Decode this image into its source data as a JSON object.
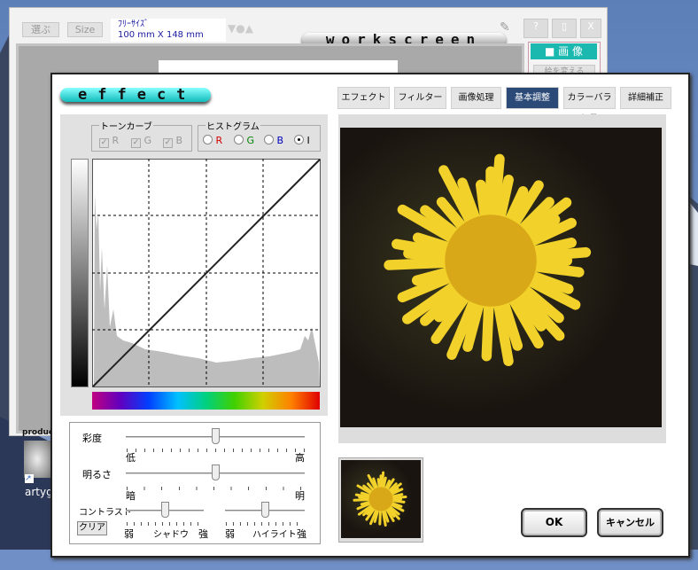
{
  "workscreen": {
    "select_label": "選ぶ",
    "size_label": "Size",
    "size_name": "ﾌﾘｰｻｲｽﾞ",
    "size_dims": "100 mm  X  148 mm",
    "logo": "workscreen",
    "help_label": "?",
    "close_label": "X",
    "image_button": "■ 画 像",
    "change_button": "絵を変える",
    "product_label": "produc"
  },
  "desktop": {
    "icon_label": "artyg"
  },
  "effect": {
    "logo": "effect",
    "tabs": [
      {
        "label": "エフェクト"
      },
      {
        "label": "フィルター"
      },
      {
        "label": "画像処理"
      },
      {
        "label": "基本調整",
        "active": true
      },
      {
        "label": "カラーバランス"
      },
      {
        "label": "詳細補正"
      }
    ],
    "tone_curve": {
      "label": "トーンカーブ",
      "channels": [
        {
          "label": "R",
          "checked": true
        },
        {
          "label": "G",
          "checked": true
        },
        {
          "label": "B",
          "checked": true
        }
      ]
    },
    "histogram": {
      "label": "ヒストグラム",
      "options": [
        {
          "label": "R",
          "color": "#d00000"
        },
        {
          "label": "G",
          "color": "#008000"
        },
        {
          "label": "B",
          "color": "#0000c0"
        },
        {
          "label": "I",
          "color": "#000000",
          "selected": true
        }
      ]
    },
    "sliders": {
      "saturation": {
        "label": "彩度",
        "min_label": "低",
        "max_label": "高",
        "value": 0.5
      },
      "brightness": {
        "label": "明るさ",
        "min_label": "暗",
        "max_label": "明",
        "value": 0.5
      },
      "contrast": {
        "label": "コントラスト",
        "shadow": {
          "label": "シャドウ",
          "min_label": "弱",
          "max_label": "強",
          "value": 0.5
        },
        "highlight": {
          "label": "ハイライト",
          "min_label": "弱",
          "max_label": "強",
          "value": 0.5
        }
      },
      "clear_label": "クリア"
    },
    "ok_label": "OK",
    "cancel_label": "キャンセル"
  }
}
